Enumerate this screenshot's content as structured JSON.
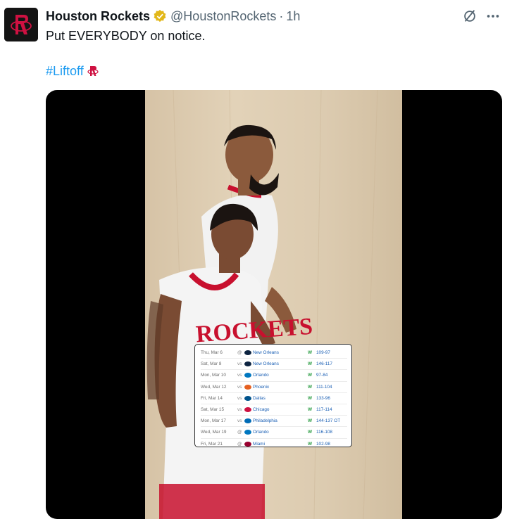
{
  "post": {
    "author_name": "Houston Rockets",
    "handle": "@HoustonRockets",
    "separator": "·",
    "time": "1h",
    "text": "Put EVERYBODY on notice.",
    "hashtag": "#Liftoff"
  },
  "icons": {
    "avatar": "rockets-logo-icon",
    "verified": "verified-badge-icon",
    "grok": "grok-icon",
    "more": "more-options-icon",
    "hashtag_emoji": "rockets-emoji-icon"
  },
  "colors": {
    "link": "#1d9bf0",
    "verified_gold": "#e2b719",
    "rockets_red": "#ce1141",
    "win_green": "#2e9e46"
  },
  "schedule": [
    {
      "date": "Thu, Mar 6",
      "vs": "@",
      "team": "New Orleans",
      "result": "W",
      "score": "109-97",
      "logo_color": "#0c2340"
    },
    {
      "date": "Sat, Mar 8",
      "vs": "vs",
      "team": "New Orleans",
      "result": "W",
      "score": "146-117",
      "logo_color": "#0c2340"
    },
    {
      "date": "Mon, Mar 10",
      "vs": "vs",
      "team": "Orlando",
      "result": "W",
      "score": "97-84",
      "logo_color": "#0077c0"
    },
    {
      "date": "Wed, Mar 12",
      "vs": "vs",
      "team": "Phoenix",
      "result": "W",
      "score": "111-104",
      "logo_color": "#e56020"
    },
    {
      "date": "Fri, Mar 14",
      "vs": "vs",
      "team": "Dallas",
      "result": "W",
      "score": "133-96",
      "logo_color": "#00538c"
    },
    {
      "date": "Sat, Mar 15",
      "vs": "vs",
      "team": "Chicago",
      "result": "W",
      "score": "117-114",
      "logo_color": "#ce1141"
    },
    {
      "date": "Mon, Mar 17",
      "vs": "vs",
      "team": "Philadelphia",
      "result": "W",
      "score": "144-137 OT",
      "logo_color": "#006bb6"
    },
    {
      "date": "Wed, Mar 19",
      "vs": "@",
      "team": "Orlando",
      "result": "W",
      "score": "116-108",
      "logo_color": "#0077c0"
    },
    {
      "date": "Fri, Mar 21",
      "vs": "@",
      "team": "Miami",
      "result": "W",
      "score": "102-98",
      "logo_color": "#98002e"
    }
  ],
  "jersey_text": "ROCKETS"
}
